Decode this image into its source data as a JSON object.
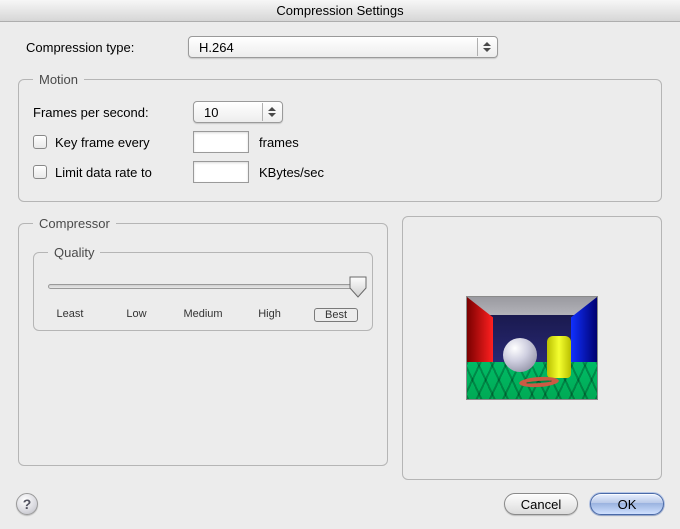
{
  "window": {
    "title": "Compression Settings"
  },
  "compression_type": {
    "label": "Compression type:",
    "value": "H.264"
  },
  "motion": {
    "legend": "Motion",
    "fps": {
      "label": "Frames per second:",
      "value": "10"
    },
    "keyframe": {
      "checked": false,
      "label": "Key frame every",
      "value": "",
      "unit": "frames"
    },
    "datarate": {
      "checked": false,
      "label": "Limit data rate to",
      "value": "",
      "unit": "KBytes/sec"
    }
  },
  "compressor": {
    "legend": "Compressor",
    "quality": {
      "legend": "Quality",
      "ticks": [
        "Least",
        "Low",
        "Medium",
        "High",
        "Best"
      ],
      "value": 4
    }
  },
  "footer": {
    "help_label": "?",
    "cancel": "Cancel",
    "ok": "OK"
  }
}
